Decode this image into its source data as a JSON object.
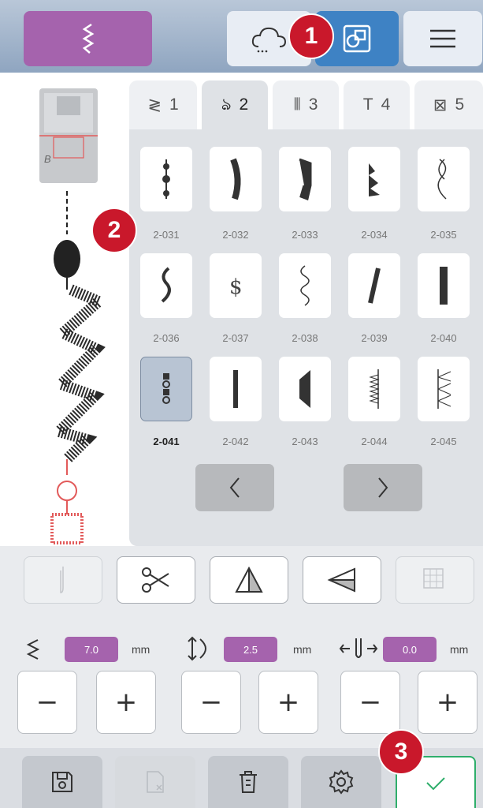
{
  "tabs": [
    {
      "label": "1",
      "icon": "zigzag-icon"
    },
    {
      "label": "2",
      "icon": "decorative-stitch-icon"
    },
    {
      "label": "3",
      "icon": "buttonhole-icon"
    },
    {
      "label": "4",
      "icon": "text-font-icon"
    },
    {
      "label": "5",
      "icon": "quilt-stitch-icon"
    }
  ],
  "stitches": [
    {
      "code": "2-031"
    },
    {
      "code": "2-032"
    },
    {
      "code": "2-033"
    },
    {
      "code": "2-034"
    },
    {
      "code": "2-035"
    },
    {
      "code": "2-036"
    },
    {
      "code": "2-037"
    },
    {
      "code": "2-038"
    },
    {
      "code": "2-039"
    },
    {
      "code": "2-040"
    },
    {
      "code": "2-041",
      "selected": true
    },
    {
      "code": "2-042"
    },
    {
      "code": "2-043"
    },
    {
      "code": "2-044"
    },
    {
      "code": "2-045"
    }
  ],
  "settings": {
    "width_value": "7.0",
    "width_unit": "mm",
    "length_value": "2.5",
    "length_unit": "mm",
    "position_value": "0.0",
    "position_unit": "mm"
  },
  "steppers": {
    "minus": "−",
    "plus": "+"
  },
  "callouts": [
    "1",
    "2",
    "3"
  ],
  "colors": {
    "accent": "#a563ad",
    "callout": "#c9182b",
    "confirm": "#2fae6b",
    "active_blue": "#3e82c4"
  }
}
